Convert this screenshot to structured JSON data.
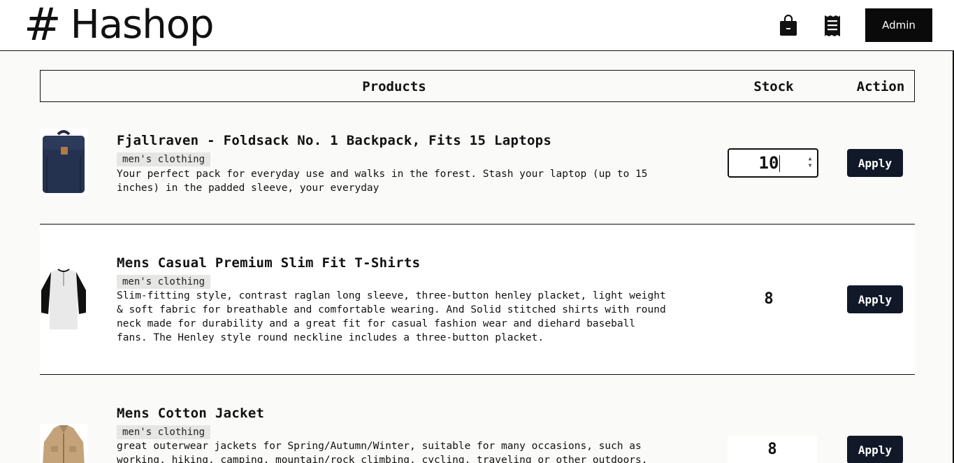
{
  "header": {
    "logo_symbol": "#",
    "logo_text": "Hashop",
    "bag_icon": "shopping-bag-icon",
    "receipt_icon": "receipt-icon",
    "admin_label": "Admin"
  },
  "table": {
    "col_products": "Products",
    "col_stock": "Stock",
    "col_action": "Action"
  },
  "products": [
    {
      "title": "Fjallraven - Foldsack No. 1 Backpack, Fits 15 Laptops",
      "category": "men's clothing",
      "description": "Your perfect pack for everyday use and walks in the forest. Stash your laptop (up to 15 inches) in the padded sleeve, your everyday",
      "stock": "10",
      "action_label": "Apply"
    },
    {
      "title": "Mens Casual Premium Slim Fit T-Shirts",
      "category": "men's clothing",
      "description": "Slim-fitting style, contrast raglan long sleeve, three-button henley placket, light weight & soft fabric for breathable and comfortable wearing. And Solid stitched shirts with round neck made for durability and a great fit for casual fashion wear and diehard baseball fans. The Henley style round neckline includes a three-button placket.",
      "stock": "8",
      "action_label": "Apply"
    },
    {
      "title": "Mens Cotton Jacket",
      "category": "men's clothing",
      "description": "great outerwear jackets for Spring/Autumn/Winter, suitable for many occasions, such as working, hiking, camping, mountain/rock climbing, cycling, traveling or other outdoors. Good",
      "stock": "8",
      "action_label": "Apply"
    }
  ],
  "colors": {
    "page_bg": "#fafaf8",
    "header_bg": "#ffffff",
    "admin_bg": "#0a0a0a",
    "apply_bg": "#111827",
    "category_bg": "#e6e6e4"
  }
}
